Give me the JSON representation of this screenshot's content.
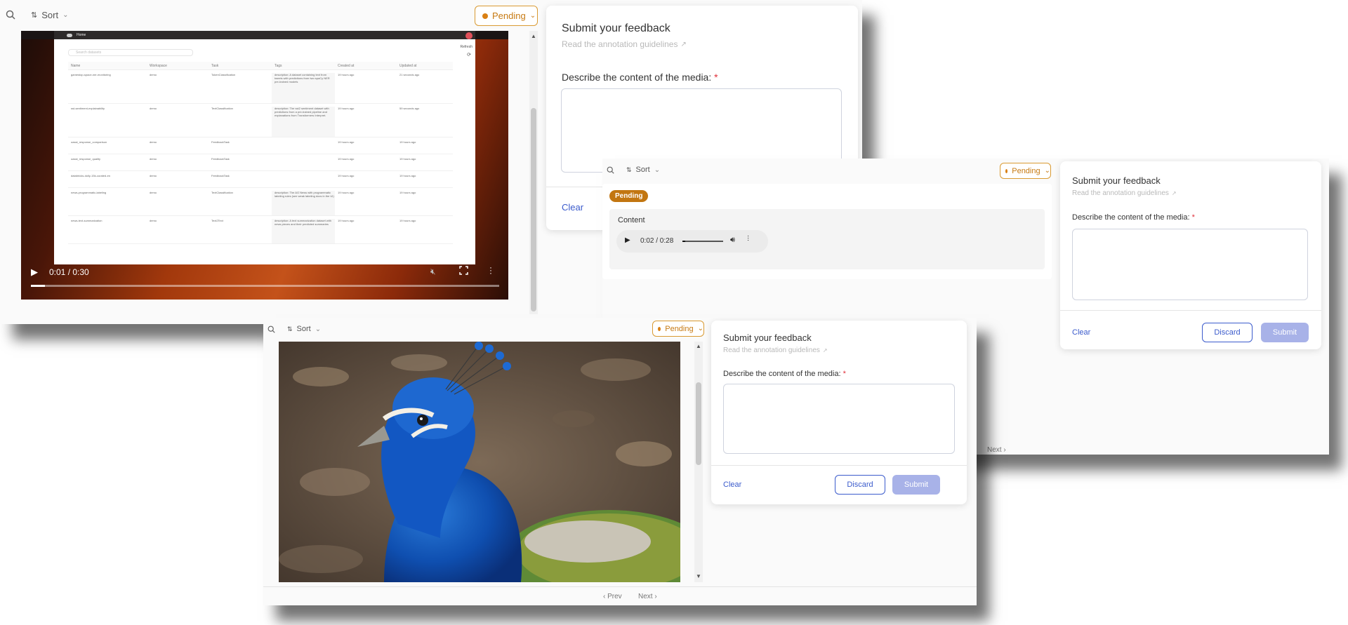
{
  "shot1": {
    "sort_label": "Sort",
    "pending_label": "Pending",
    "video": {
      "time": "0:01 / 0:30",
      "progress": 0.03,
      "inner_app": {
        "home_label": "Home",
        "refresh_label": "Refresh",
        "search_placeholder": "Search datasets",
        "columns": [
          "Name",
          "Workspace",
          "Task",
          "Tags",
          "Created at",
          "Updated at"
        ],
        "rows": [
          {
            "name": "gamestop-space-ner-monitoring",
            "workspace": "demo",
            "task": "TokenClassification",
            "tags": "description: A dataset containing text from tweets with predictions from two spaCy NER pre-trained models",
            "created": "19 hours ago",
            "updated": "21 seconds ago"
          },
          {
            "name": "sst-sentiment-explainability",
            "workspace": "demo",
            "task": "TextClassification",
            "tags": "description: The sst2 sentiment dataset with predictions from a pre-trained pipeline and explanations from Transformers Interpret.",
            "created": "19 hours ago",
            "updated": "59 seconds ago"
          },
          {
            "name": "oasst_response_comparison",
            "workspace": "demo",
            "task": "FeedbackTask",
            "tags": "",
            "created": "19 hours ago",
            "updated": "19 hours ago"
          },
          {
            "name": "oasst_response_quality",
            "workspace": "demo",
            "task": "FeedbackTask",
            "tags": "",
            "created": "19 hours ago",
            "updated": "19 hours ago"
          },
          {
            "name": "databricks-dolly-15k-curated-en",
            "workspace": "demo",
            "task": "FeedbackTask",
            "tags": "",
            "created": "19 hours ago",
            "updated": "19 hours ago"
          },
          {
            "name": "news-programmatic-labeling",
            "workspace": "demo",
            "task": "TextClassification",
            "tags": "description: The AG News with programmatic labeling rules (see weak labeling docs in the UI)",
            "created": "19 hours ago",
            "updated": "19 hours ago"
          },
          {
            "name": "news-text-summarization",
            "workspace": "demo",
            "task": "Text2Text",
            "tags": "description: A text summarization dataset with news pieces and their predicted summaries",
            "created": "19 hours ago",
            "updated": "19 hours ago"
          }
        ]
      }
    },
    "form": {
      "title": "Submit your feedback",
      "guidelines": "Read the annotation guidelines",
      "question": "Describe the content of the media:",
      "required_mark": "*",
      "clear_label": "Clear"
    }
  },
  "shot2": {
    "sort_label": "Sort",
    "pending_label": "Pending",
    "status_badge": "Pending",
    "content_label": "Content",
    "audio_time": "0:02 / 0:28",
    "audio_progress": 0.07,
    "next_label": "Next",
    "form": {
      "title": "Submit your feedback",
      "guidelines": "Read the annotation guidelines",
      "question": "Describe the content of the media:",
      "required_mark": "*",
      "clear_label": "Clear",
      "discard_label": "Discard",
      "submit_label": "Submit"
    }
  },
  "shot3": {
    "sort_label": "Sort",
    "pending_label": "Pending",
    "prev_label": "Prev",
    "next_label": "Next",
    "form": {
      "title": "Submit your feedback",
      "guidelines": "Read the annotation guidelines",
      "question": "Describe the content of the media:",
      "required_mark": "*",
      "clear_label": "Clear",
      "discard_label": "Discard",
      "submit_label": "Submit"
    }
  },
  "colors": {
    "pending": "#d98014",
    "primary": "#3b5bcc",
    "submit_disabled": "#a8b2e8",
    "required": "#e0303a"
  }
}
